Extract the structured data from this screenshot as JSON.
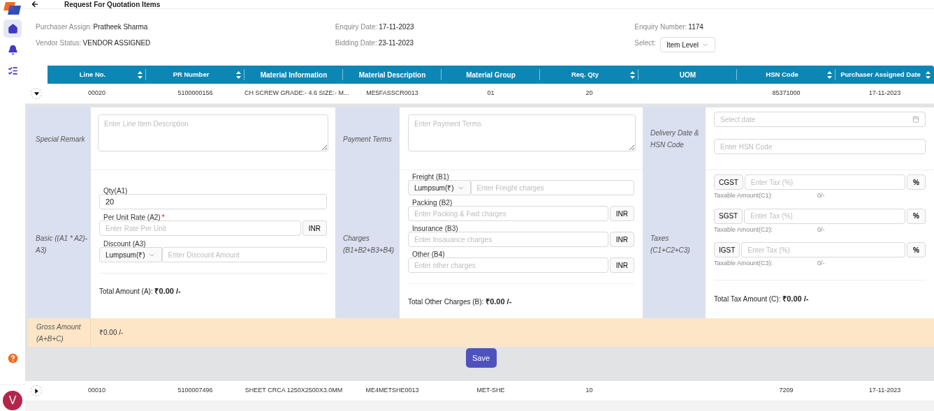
{
  "sidebar": {
    "items": [
      {
        "selected": true
      },
      {
        "selected": false
      },
      {
        "selected": false
      }
    ],
    "avatar": {
      "initial": "V"
    }
  },
  "header": {
    "title": "Request For Quotation Items"
  },
  "info_fields": [
    {
      "kind": "text",
      "label": "Purchaser Assign:",
      "value": "Pratheek Sharma"
    },
    {
      "kind": "text",
      "label": "Enquiry Date:",
      "value": "17-11-2023"
    },
    {
      "kind": "text",
      "label": "Enquiry Number:",
      "value": "1174"
    },
    {
      "kind": "text",
      "label": "Vendor Status:",
      "value": "VENDOR ASSIGNED"
    },
    {
      "kind": "text",
      "label": "Bidding Date:",
      "value": "23-11-2023"
    },
    {
      "kind": "select",
      "label": "Select:",
      "value": "Item Level"
    }
  ],
  "table": {
    "columns": [
      {
        "label": "Line No.",
        "sortable": true
      },
      {
        "label": "PR Number",
        "sortable": true
      },
      {
        "label": "Material Information",
        "sortable": false
      },
      {
        "label": "Material Description",
        "sortable": false
      },
      {
        "label": "Material Group",
        "sortable": false
      },
      {
        "label": "Req. Qty",
        "sortable": true
      },
      {
        "label": "UOM",
        "sortable": false
      },
      {
        "label": "HSN Code",
        "sortable": true
      },
      {
        "label": "Purchaser Assigned Date",
        "sortable": true
      }
    ],
    "rows": [
      {
        "expanded": true,
        "cells": [
          "00020",
          "5100000156",
          "CH SCREW GRADE:- 4.6 SIZE:- M...",
          "ME5FASSCR0013",
          "01",
          "20",
          "",
          "85371000",
          "17-11-2023"
        ]
      },
      {
        "expanded": false,
        "cells": [
          "00010",
          "5100007496",
          "SHEET CRCA 1250X2500X3.0MM",
          "ME4METSHE0013",
          "MET-SHE",
          "10",
          "",
          "7209",
          "17-11-2023"
        ]
      }
    ]
  },
  "detail": {
    "special_remark": {
      "label": "Special Remark",
      "placeholder": "Enter Line Item Description"
    },
    "payment_terms": {
      "label": "Payment Terms",
      "placeholder": "Enter Payment Terms"
    },
    "delivery": {
      "label": "Delivery Date & HSN Code",
      "date_placeholder": "Select date",
      "hsn_placeholder": "Enter HSN Code"
    },
    "basic": {
      "label": "Basic ((A1 * A2)- A3)",
      "fields": [
        {
          "kind": "input",
          "label": "Qty(A1)",
          "value": "20"
        },
        {
          "kind": "addon",
          "label": "Per Unit Rate (A2)",
          "required_mark": "*",
          "placeholder": "Enter Rate Per Unit",
          "addon": "INR"
        },
        {
          "kind": "select",
          "label": "Discount (A3)",
          "select": "Lumpsum(₹)",
          "placeholder": "Enter Discount Amount"
        }
      ],
      "total_label": "Total Amount (A):",
      "total_value": "₹0.00 /-"
    },
    "charges": {
      "label": "Charges (B1+B2+B3+B4)",
      "fields": [
        {
          "kind": "select",
          "label": "Freight (B1)",
          "select": "Lumpsum(₹)",
          "placeholder": "Enter Freight charges"
        },
        {
          "kind": "addon",
          "label": "Packing (B2)",
          "placeholder": "Enter Packing & Fwd charges",
          "addon": "INR"
        },
        {
          "kind": "addon",
          "label": "Insurance (B3)",
          "placeholder": "Enter Insauance charges",
          "addon": "INR"
        },
        {
          "kind": "addon",
          "label": "Other (B4)",
          "placeholder": "Enter other charges",
          "addon": "INR"
        }
      ],
      "total_label": "Total Other Charges (B):",
      "total_value": "₹0.00 /-"
    },
    "taxes": {
      "label": "Taxes (C1+C2+C3)",
      "items": [
        {
          "name": "CGST",
          "placeholder": "Enter Tax (%)",
          "addon": "%",
          "taxable_label": "Taxable Amount(C1):",
          "taxable_value": "0/-"
        },
        {
          "name": "SGST",
          "placeholder": "Enter Tax (%)",
          "addon": "%",
          "taxable_label": "Taxable Amount(C2):",
          "taxable_value": "0/-"
        },
        {
          "name": "IGST",
          "placeholder": "Enter Tax (%)",
          "addon": "%",
          "taxable_label": "Taxable Amount(C3):",
          "taxable_value": "0/-"
        }
      ],
      "total_label": "Total Tax Amount (C):",
      "total_value": "₹0.00 /-"
    },
    "gross": {
      "label": "Gross Amount (A+B+C)",
      "value": "₹0.00 /-"
    },
    "save_button": "Save"
  }
}
